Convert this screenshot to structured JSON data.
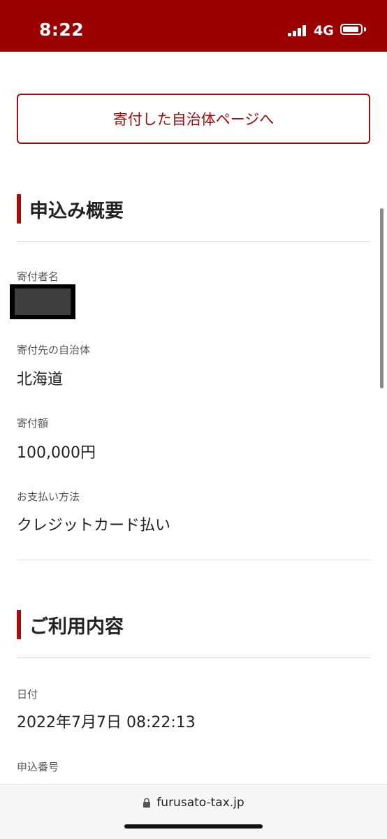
{
  "status_bar": {
    "time": "8:22",
    "network": "4G",
    "signal_icon": "cellular-signal-icon",
    "battery_icon": "battery-icon",
    "background_color": "#9b0000"
  },
  "municipality_button": {
    "label": "寄付した自治体ページへ",
    "accent_color": "#a30d0d"
  },
  "application_summary": {
    "heading": "申込み概要",
    "fields": [
      {
        "label": "寄付者名",
        "value": ""
      },
      {
        "label": "寄付先の自治体",
        "value": "北海道"
      },
      {
        "label": "寄付額",
        "value": "100,000円"
      },
      {
        "label": "お支払い方法",
        "value": "クレジットカード払い"
      }
    ]
  },
  "usage_details": {
    "heading": "ご利用内容",
    "fields": [
      {
        "label": "日付",
        "value": "2022年7月7日 08:22:13"
      },
      {
        "label": "申込番号",
        "value": ""
      }
    ]
  },
  "browser": {
    "url": "furusato-tax.jp",
    "lock_icon": "lock-icon"
  }
}
